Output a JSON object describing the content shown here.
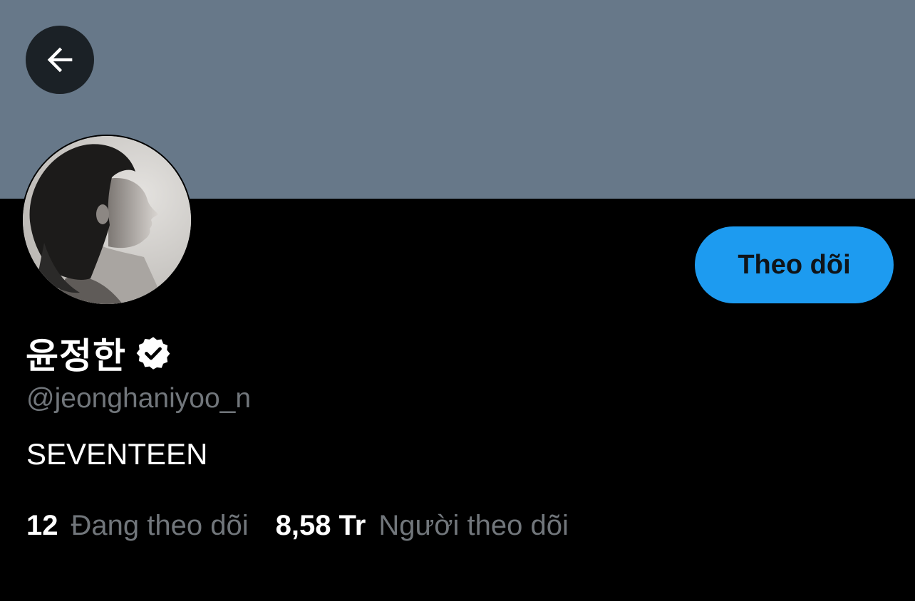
{
  "header": {
    "banner_color": "#677889",
    "back_icon": "arrow-left-icon"
  },
  "profile": {
    "display_name": "윤정한",
    "verified_icon": "verified-badge-icon",
    "handle": "@jeonghaniyoo_n",
    "bio": "SEVENTEEN",
    "follow_label": "Theo dõi",
    "accent_color": "#1d9bf0"
  },
  "stats": {
    "following": {
      "count": "12",
      "label": "Đang theo dõi"
    },
    "followers": {
      "count": "8,58 Tr",
      "label": "Người theo dõi"
    }
  }
}
